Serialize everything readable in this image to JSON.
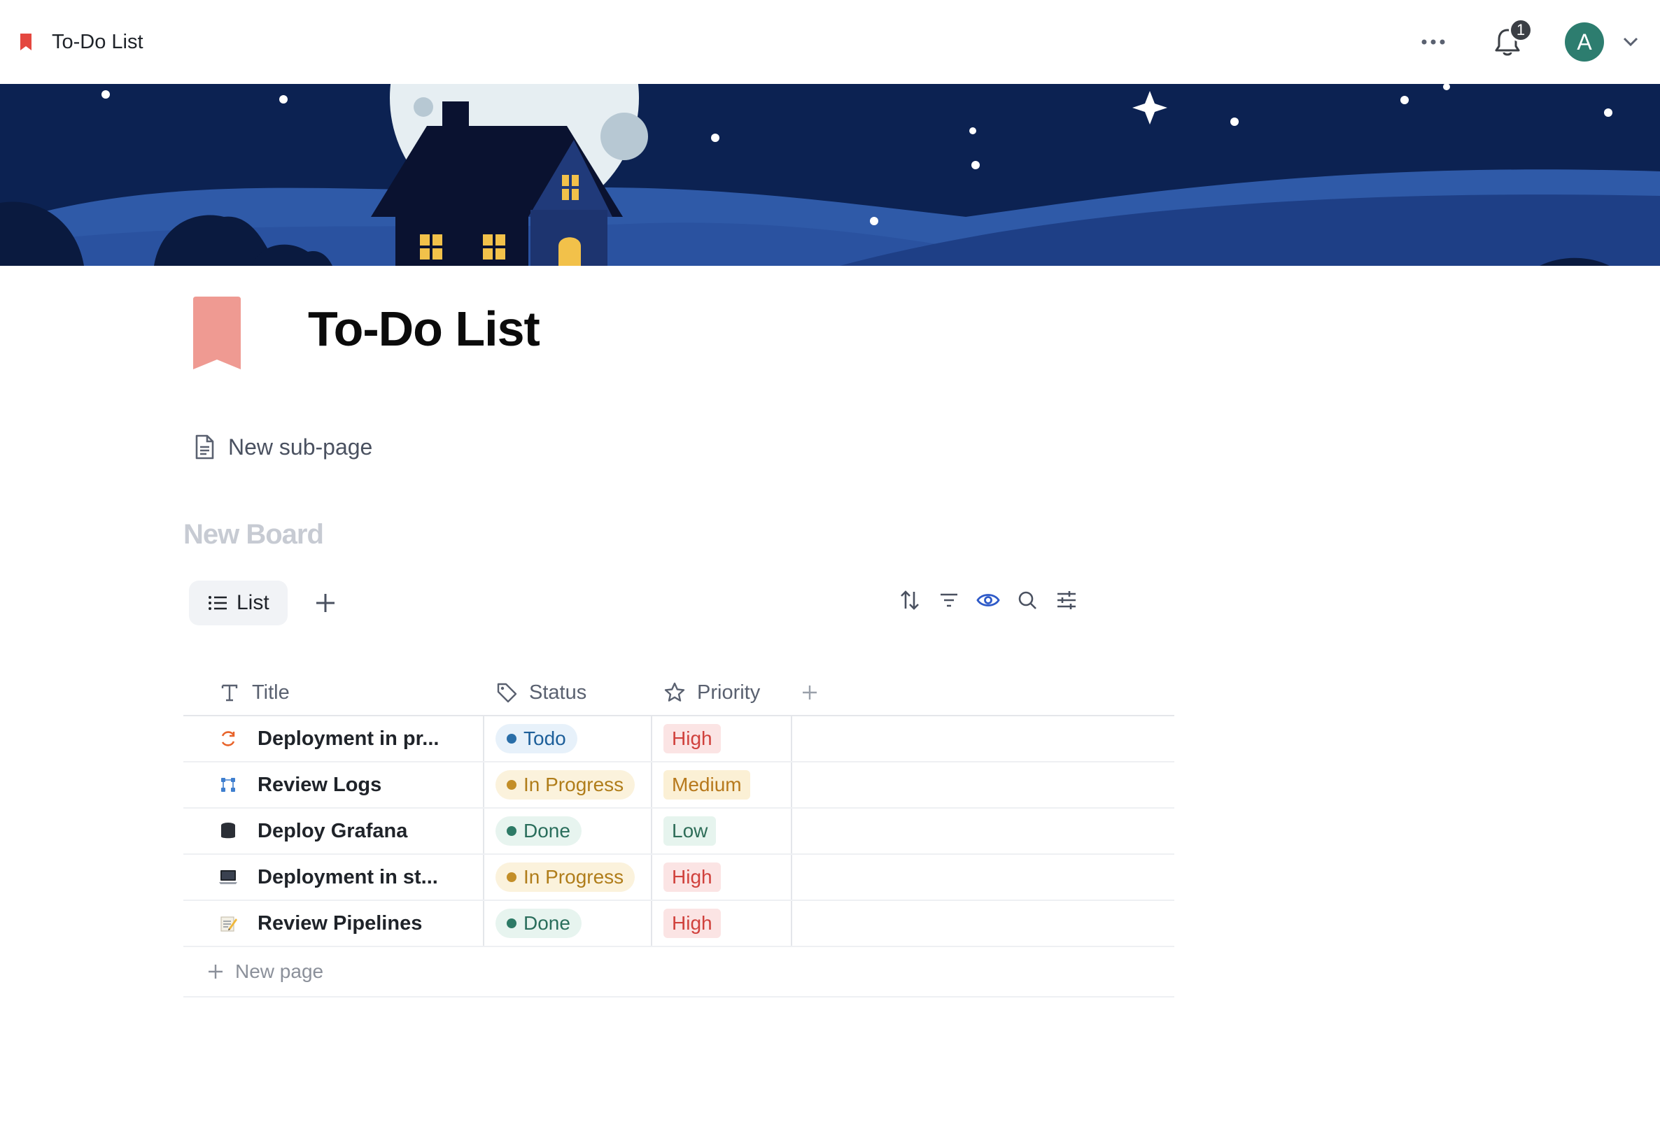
{
  "topbar": {
    "title": "To-Do List",
    "notification_count": "1",
    "avatar_initial": "A",
    "accent_color": "#e4473f",
    "avatar_color": "#2d7d6f"
  },
  "page": {
    "title": "To-Do List",
    "icon": "bookmark-icon",
    "icon_color": "#ef9a92"
  },
  "subpage": {
    "label": "New sub-page"
  },
  "board": {
    "title": "New Board",
    "views": [
      {
        "label": "List",
        "icon": "list-icon"
      }
    ],
    "columns": [
      {
        "label": "Title",
        "icon": "text-icon"
      },
      {
        "label": "Status",
        "icon": "tag-icon"
      },
      {
        "label": "Priority",
        "icon": "star-icon"
      }
    ],
    "rows": [
      {
        "title": "Deployment in pr...",
        "icon": "refresh-icon",
        "status": "Todo",
        "status_kind": "todo",
        "priority": "High",
        "priority_kind": "high"
      },
      {
        "title": "Review Logs",
        "icon": "nodes-icon",
        "status": "In Progress",
        "status_kind": "progress",
        "priority": "Medium",
        "priority_kind": "medium"
      },
      {
        "title": "Deploy Grafana",
        "icon": "database-icon",
        "status": "Done",
        "status_kind": "done",
        "priority": "Low",
        "priority_kind": "low"
      },
      {
        "title": "Deployment in st...",
        "icon": "laptop-icon",
        "status": "In Progress",
        "status_kind": "progress",
        "priority": "High",
        "priority_kind": "high"
      },
      {
        "title": "Review Pipelines",
        "icon": "memo-icon",
        "status": "Done",
        "status_kind": "done",
        "priority": "High",
        "priority_kind": "high"
      }
    ],
    "new_page_label": "New page"
  }
}
